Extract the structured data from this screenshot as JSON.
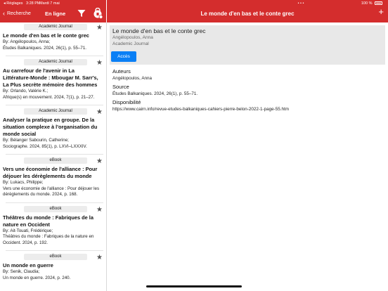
{
  "status_bar": {
    "back_app": "◂ Réglages",
    "time": "3:28 PM",
    "date": "Mardi 7 mai",
    "battery": "100 %",
    "dots": "• • •"
  },
  "left_header": {
    "back_label": "Recherche",
    "online_label": "En ligne",
    "icons": [
      "filter-icon",
      "lock-icon"
    ]
  },
  "right_header": {
    "title": "Le monde d'en bas et le conte grec",
    "add_label": "+"
  },
  "results": [
    {
      "badge": "Academic Journal",
      "title": "Le monde d'en bas et le conte grec",
      "lines": [
        "By: Angélopoulos, Anna;",
        "Études Balkaniques. 2024, 26(1), p. 55–71."
      ]
    },
    {
      "badge": "Academic Journal",
      "title": "Au carrefour de l'avenir in La Littérature-Monde : Mbougar M. Sarr's, La Plus secrète mémoire des hommes",
      "lines": [
        "By: Orlando, Valérie K.;",
        "Afrique(s) en mouvement. 2024, 7(1), p. 21–27."
      ]
    },
    {
      "badge": "Academic Journal",
      "title": "Analyser la pratique en groupe. De la situation complexe à l'organisation du monde social",
      "lines": [
        "By: Bélanger Sabourin, Catherine;",
        "Sociographe. 2024, 85(1), p. LXVI–LXXXIV."
      ]
    },
    {
      "badge": "eBook",
      "title": "Vers une économie de l'alliance : Pour déjouer les dérèglements du monde",
      "lines": [
        "By: Lukacs, Philippe;",
        "Vers une économie de l'alliance : Pour déjouer les dérèglements du monde. 2024, p. 168."
      ]
    },
    {
      "badge": "eBook",
      "title": "Théâtres du monde : Fabriques de la nature en Occident",
      "lines": [
        "By: Ait-Touati, Frédérique;",
        "Théâtres du monde : Fabriques de la nature en Occident. 2024, p. 192."
      ]
    },
    {
      "badge": "eBook",
      "title": "Un monde en guerre",
      "lines": [
        "By: Senik, Claudia;",
        "Un monde en guerre. 2024, p. 240."
      ]
    }
  ],
  "detail": {
    "title": "Le monde d'en bas et le conte grec",
    "author": "Angélopoulos, Anna",
    "type": "Academic Journal",
    "access_label": "Accès",
    "authors_label": "Auteurs",
    "authors_value": "Angélopoulos, Anna",
    "source_label": "Source",
    "source_value": "Études Balkaniques. 2024, 26(1), p. 55–71.",
    "availability_label": "Disponibilité",
    "availability_value": "https://www.cairn.info/revue-etudes-balkaniques-cahiers-pierre-belon-2022-1-page-55.htm"
  },
  "colors": {
    "header": "#d42d2d",
    "accent": "#0a7ff5"
  }
}
